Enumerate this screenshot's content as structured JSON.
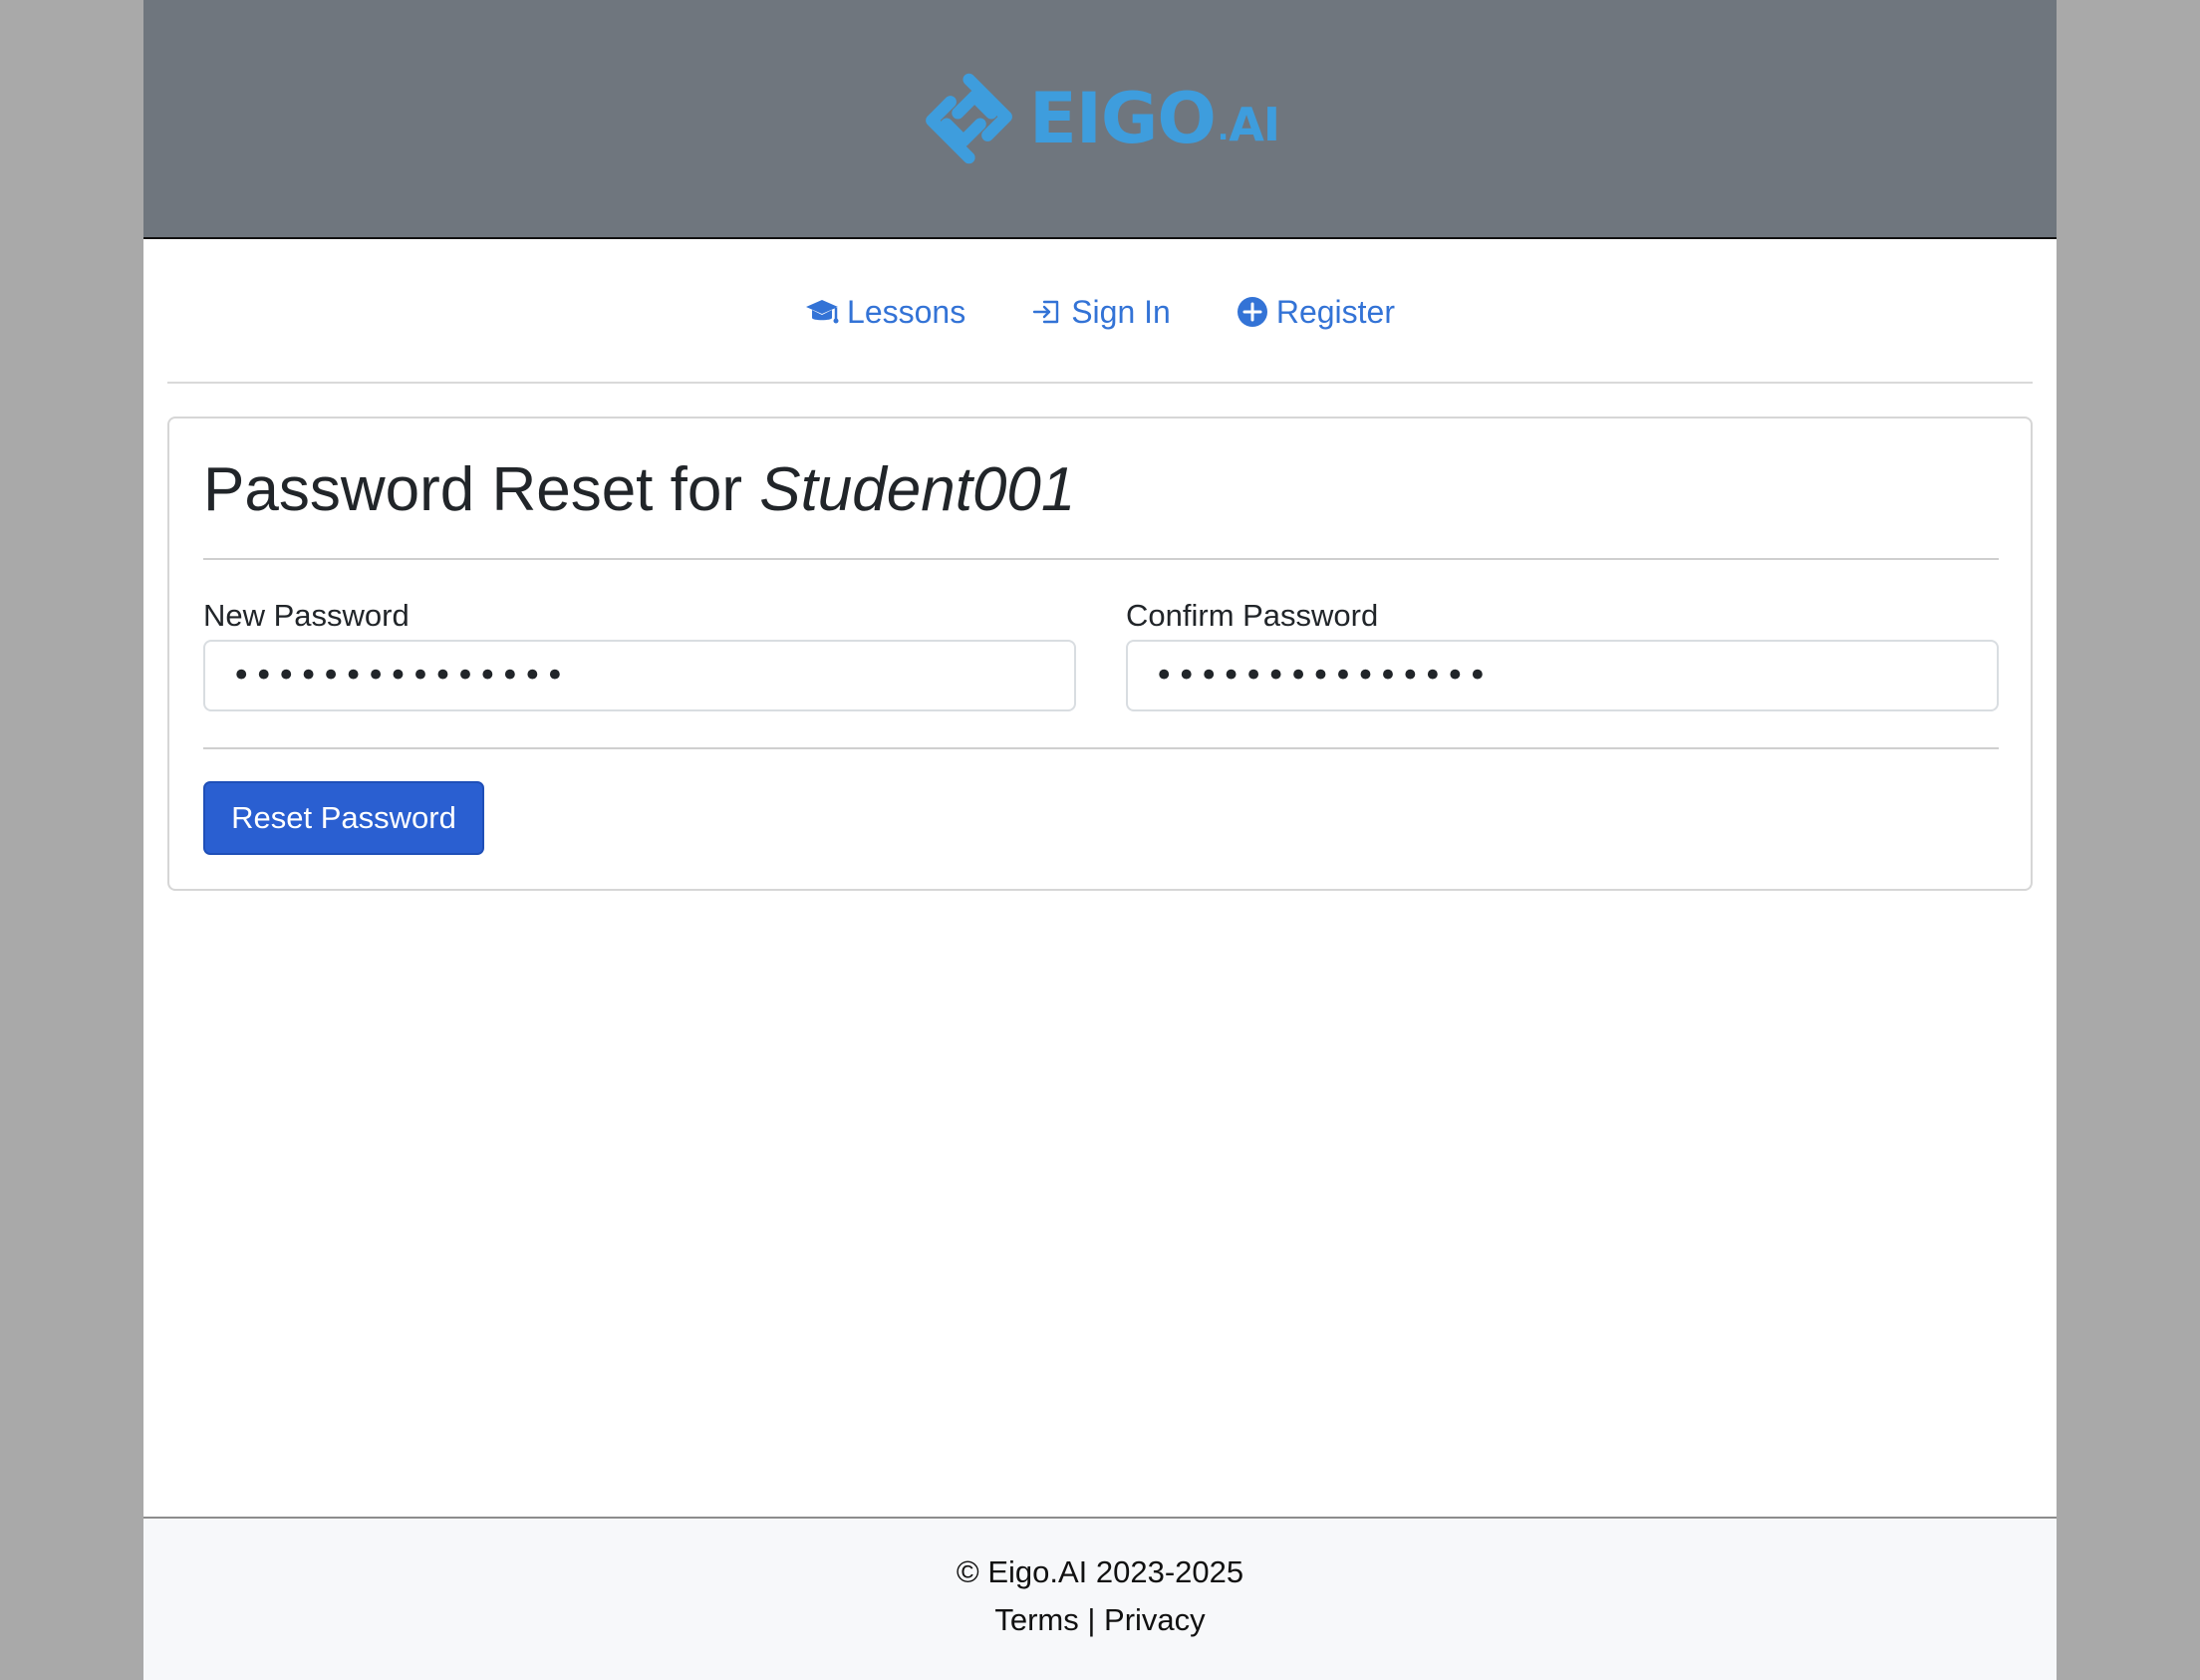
{
  "brand": {
    "logo_main": "EIGO",
    "logo_dot": ".",
    "logo_suffix": "AI",
    "color": "#3e9ddd"
  },
  "nav": {
    "items": [
      {
        "label": "Lessons",
        "icon": "graduation-cap-icon"
      },
      {
        "label": "Sign In",
        "icon": "sign-in-icon"
      },
      {
        "label": "Register",
        "icon": "plus-circle-icon"
      }
    ],
    "link_color": "#3373d6"
  },
  "form": {
    "title_prefix": "Password Reset for ",
    "username": "Student001",
    "new_password_label": "New Password",
    "new_password_value": "•••••••••••••••",
    "confirm_password_label": "Confirm Password",
    "confirm_password_value": "•••••••••••••••",
    "submit_label": "Reset Password",
    "button_color": "#2a5fd1"
  },
  "footer": {
    "copyright": "© Eigo.AI 2023-2025",
    "terms_label": "Terms",
    "separator": " | ",
    "privacy_label": "Privacy"
  }
}
